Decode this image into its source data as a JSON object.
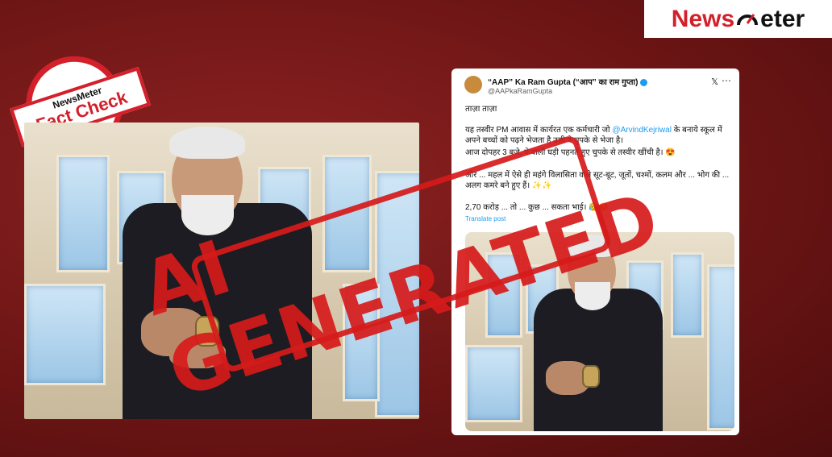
{
  "logo": {
    "news": "News",
    "meter": "eter"
  },
  "fact_check_stamp": {
    "top": "NewsMeter",
    "bottom": "Fact Check"
  },
  "tweet": {
    "name": "“AAP” Ka Ram Gupta (“आप” का राम गुप्ता)",
    "handle": "@AAPkaRamGupta",
    "x_icon": "x-logo-icon",
    "more_icon": "more-icon",
    "line1": "ताज़ा ताज़ा",
    "para1_a": "यह तस्वीर PM आवास में कार्यरत एक कर्मचारी जो ",
    "para1_mention": "@ArvindKejriwal",
    "para1_b": " के बनाये स्कूल में अपने बच्चों को पढ़ने भेजता है उसी ने चुपके से भेजा है।",
    "para2": "आज दोपहर 3 बजे, ये वाली घड़ी पहनते हुए चुपके से तस्वीर खींची है। 😍",
    "para3": "और ... महल में ऐसे ही महंगे विलासिता वाले सूट-बूट, जूतों, चश्मों, कलम और ... भोग की ... अलग कमरे बने हुए हैं। ✨✨",
    "para4": "2,70 करोड़ ... तो ... कुछ ... सकता भाई। 😥😥",
    "translate": "Translate post"
  },
  "ai_stamp": {
    "text": "AI GENERATED"
  },
  "colors": {
    "brand_red": "#d3202a",
    "stamp_red": "#d61a1a",
    "background": "#7a1a1a"
  }
}
